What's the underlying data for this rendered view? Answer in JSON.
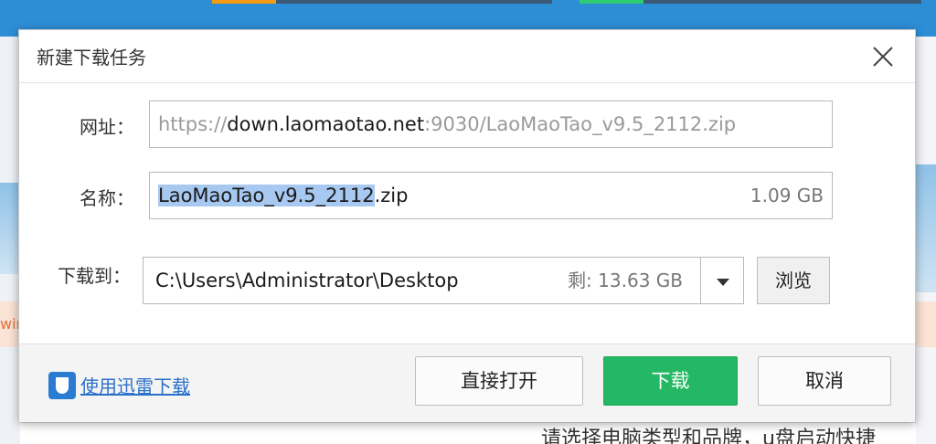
{
  "dialog": {
    "title": "新建下载任务",
    "url_label": "网址：",
    "url_prefix": "https://",
    "url_host": "down.laomaotao.net",
    "url_rest": ":9030/LaoMaoTao_v9.5_2112.zip",
    "name_label": "名称：",
    "name_selected": "LaoMaoTao_v9.5_2112",
    "name_ext": ".zip",
    "file_size": "1.09 GB",
    "saveto_label": "下载到：",
    "save_path": "C:\\Users\\Administrator\\Desktop",
    "free_space": "剩: 13.63 GB",
    "browse_label": "浏览",
    "thunder_link": "使用迅雷下载",
    "open_direct": "直接打开",
    "download": "下载",
    "cancel": "取消"
  },
  "background": {
    "left_fragment": "win",
    "bottom_fragment": "请选择电脑类型和品牌，u盘启动快捷"
  },
  "colors": {
    "download_green": "#25b864",
    "link_blue": "#2a6fc9",
    "selection": "#a7c8f0"
  },
  "icons": {
    "close": "close-icon",
    "dropdown": "chevron-down-icon",
    "thunder": "thunder-icon"
  }
}
